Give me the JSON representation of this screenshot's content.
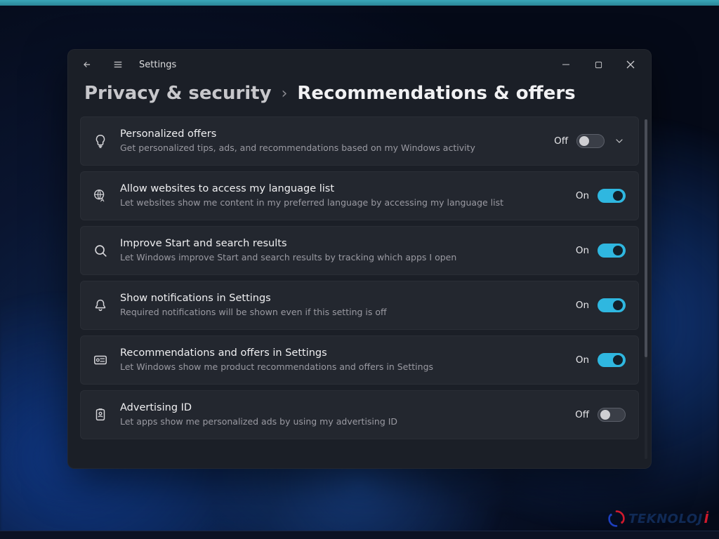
{
  "app": {
    "title": "Settings"
  },
  "breadcrumb": {
    "parent": "Privacy & security",
    "separator": "›",
    "current": "Recommendations & offers"
  },
  "toggle_labels": {
    "on": "On",
    "off": "Off"
  },
  "rows": [
    {
      "icon": "lightbulb",
      "title": "Personalized offers",
      "desc": "Get personalized tips, ads, and recommendations based on my Windows activity",
      "state": "off",
      "expandable": true
    },
    {
      "icon": "globe-lang",
      "title": "Allow websites to access my language list",
      "desc": "Let websites show me content in my preferred language by accessing my language list",
      "state": "on",
      "expandable": false
    },
    {
      "icon": "search",
      "title": "Improve Start and search results",
      "desc": "Let Windows improve Start and search results by tracking which apps I open",
      "state": "on",
      "expandable": false
    },
    {
      "icon": "bell",
      "title": "Show notifications in Settings",
      "desc": "Required notifications will be shown even if this setting is off",
      "state": "on",
      "expandable": false
    },
    {
      "icon": "card-offer",
      "title": "Recommendations and offers in Settings",
      "desc": "Let Windows show me product recommendations and offers in Settings",
      "state": "on",
      "expandable": false
    },
    {
      "icon": "badge-id",
      "title": "Advertising ID",
      "desc": "Let apps show me personalized ads by using my advertising ID",
      "state": "off",
      "expandable": false
    }
  ],
  "watermark": {
    "part1": "TEKNOLOJ",
    "part2": "İ"
  },
  "colors": {
    "accent": "#2fb7e0",
    "window_bg": "#1b1f27",
    "row_bg": "#23272f"
  }
}
